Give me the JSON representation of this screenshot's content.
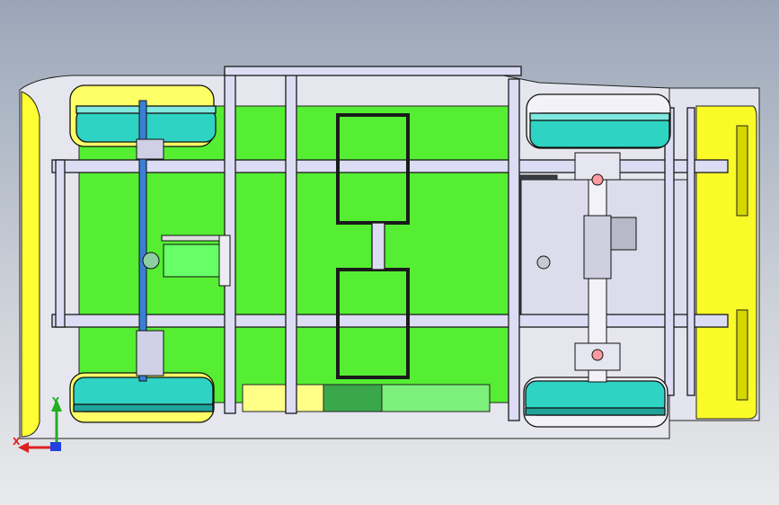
{
  "viewport": {
    "triad": {
      "x_label": "X",
      "y_label": "Y",
      "x_color": "#e02020",
      "y_color": "#20b020",
      "z_color": "#2040e0"
    },
    "model": {
      "body_color": "#d8d8e8",
      "floor_color": "#55ee33",
      "tire_color": "#2fd3c3",
      "fender_color": "#ffff22",
      "frame_color": "#dcdcf4",
      "steering_color": "#3a7fd6",
      "edge_color": "#202020"
    },
    "icons": [
      "coordinate-triad-icon"
    ]
  }
}
